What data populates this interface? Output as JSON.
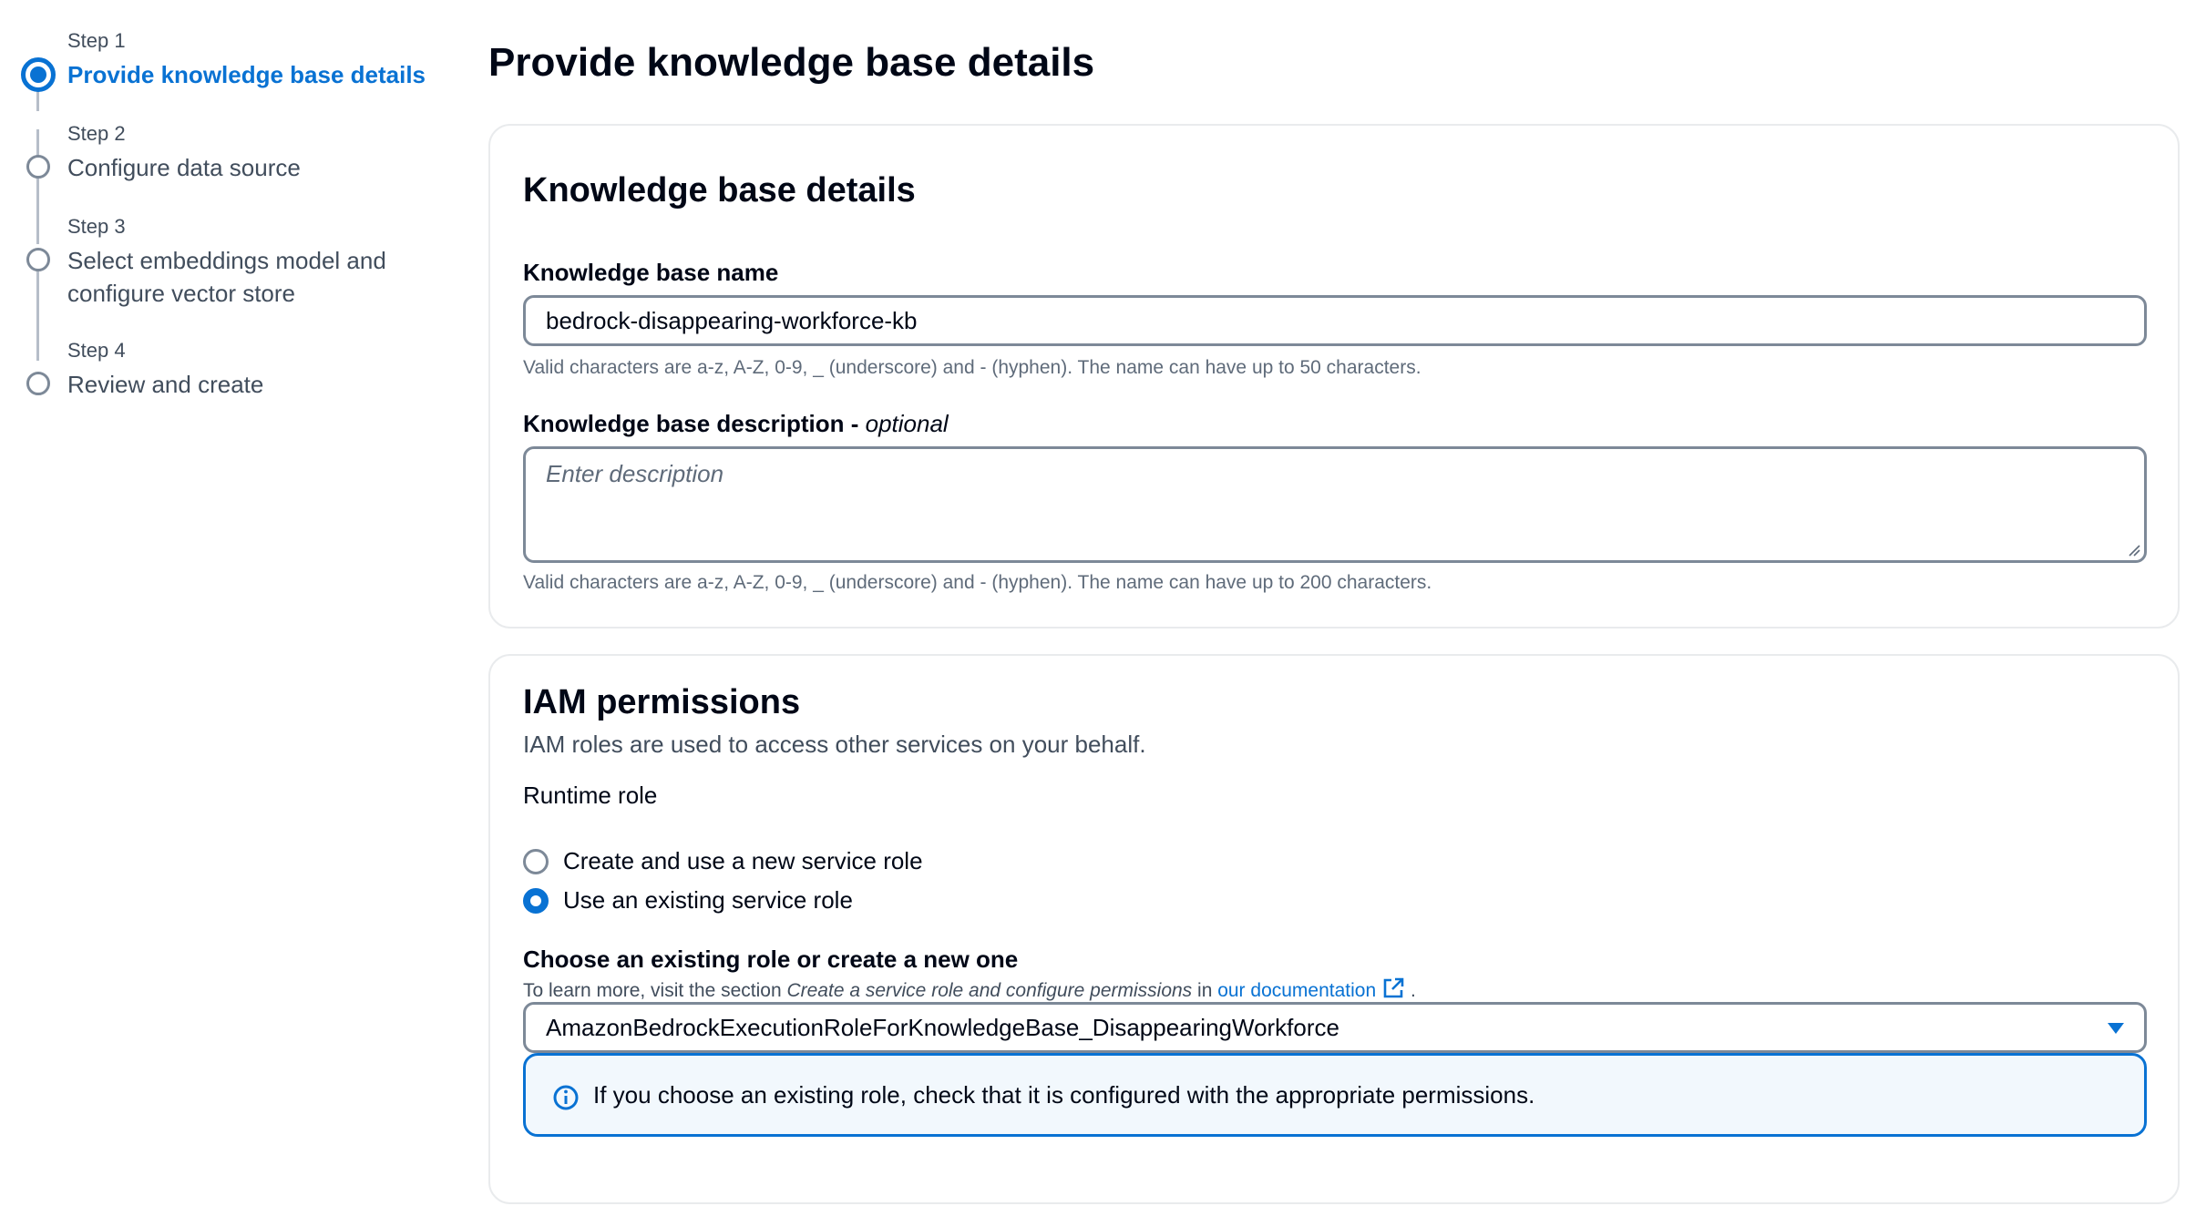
{
  "wizard": {
    "steps": [
      {
        "number": "Step 1",
        "title": "Provide knowledge base details",
        "state": "active"
      },
      {
        "number": "Step 2",
        "title": "Configure data source",
        "state": "pending"
      },
      {
        "number": "Step 3",
        "title": "Select embeddings model and configure vector store",
        "state": "pending"
      },
      {
        "number": "Step 4",
        "title": "Review and create",
        "state": "pending"
      }
    ]
  },
  "page": {
    "title": "Provide knowledge base details"
  },
  "details": {
    "title": "Knowledge base details",
    "name_label": "Knowledge base name",
    "name_value": "bedrock-disappearing-workforce-kb",
    "name_constraint": "Valid characters are a-z, A-Z, 0-9, _ (underscore) and - (hyphen). The name can have up to 50 characters.",
    "description_label": "Knowledge base description - ",
    "description_optional": "optional",
    "description_placeholder": "Enter description",
    "description_constraint": "Valid characters are a-z, A-Z, 0-9, _ (underscore) and - (hyphen). The name can have up to 200 characters."
  },
  "iam": {
    "title": "IAM permissions",
    "description": "IAM roles are used to access other services on your behalf.",
    "runtime_role_label": "Runtime role",
    "options": [
      {
        "label": "Create and use a new service role",
        "checked": false
      },
      {
        "label": "Use an existing service role",
        "checked": true
      }
    ],
    "choose_label": "Choose an existing role or create a new one",
    "help_prefix": "To learn more, visit the section ",
    "help_section": "Create a service role and configure permissions",
    "help_in": " in ",
    "help_link": "our documentation",
    "help_suffix": ".",
    "selected_role": "AmazonBedrockExecutionRoleForKnowledgeBase_DisappearingWorkforce",
    "alert_text": "If you choose an existing role, check that it is configured with the appropriate permissions."
  },
  "colors": {
    "accent": "#0972d3",
    "border": "#7d8998",
    "container_border": "#e9ebed",
    "info_bg": "#f2f8fd"
  },
  "icons": {
    "external_link": "external-link-icon",
    "caret": "caret-down-icon",
    "info": "info-icon"
  }
}
